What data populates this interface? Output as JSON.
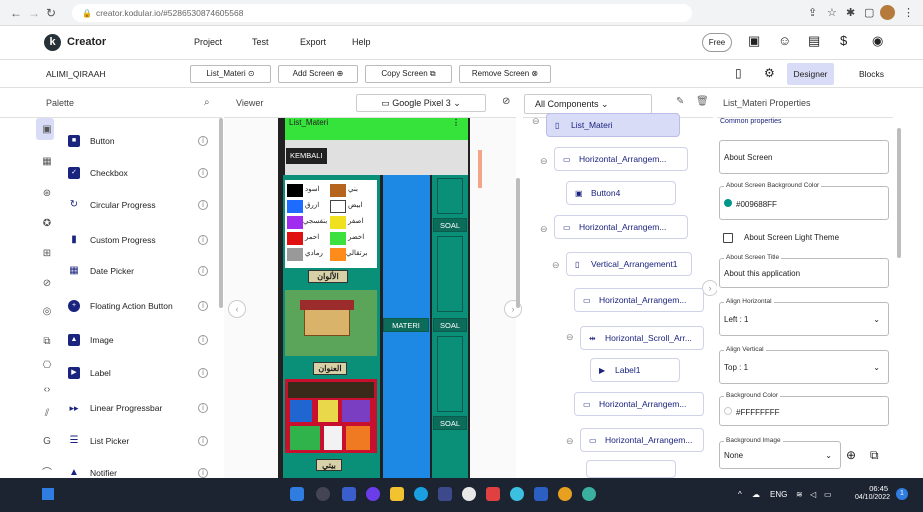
{
  "browser": {
    "url": "creator.kodular.io/#5286530874605568"
  },
  "header": {
    "brand": "Creator",
    "menu": [
      "Project",
      "Test",
      "Export",
      "Help"
    ],
    "free_label": "Free"
  },
  "toolbar": {
    "project_name": "ALIMI_QIRAAH",
    "screen_select": "List_Materi ⊙",
    "add_screen": "Add Screen ⊕",
    "copy_screen": "Copy Screen ⧉",
    "remove_screen": "Remove Screen ⊗",
    "designer": "Designer",
    "blocks": "Blocks"
  },
  "palette": {
    "title": "Palette",
    "items": [
      {
        "label": "Button",
        "icon": "button-icon"
      },
      {
        "label": "Checkbox",
        "icon": "checkbox-icon"
      },
      {
        "label": "Circular Progress",
        "icon": "circular-progress-icon"
      },
      {
        "label": "Custom Progress",
        "icon": "custom-progress-icon"
      },
      {
        "label": "Date Picker",
        "icon": "date-picker-icon"
      },
      {
        "label": "Floating Action Button",
        "icon": "fab-icon"
      },
      {
        "label": "Image",
        "icon": "image-icon"
      },
      {
        "label": "Label",
        "icon": "label-icon"
      },
      {
        "label": "Linear Progressbar",
        "icon": "linear-progress-icon"
      },
      {
        "label": "List Picker",
        "icon": "list-picker-icon"
      },
      {
        "label": "Notifier",
        "icon": "notifier-icon"
      }
    ]
  },
  "viewer": {
    "title": "Viewer",
    "device": "Google Pixel 3",
    "screen_title": "List_Materi",
    "back_button": "KEMBALI",
    "colors_left": [
      "اسود",
      "ازرق",
      "بنفسجي",
      "احمر",
      "رمادي"
    ],
    "colors_right": [
      "بني",
      "ابيض",
      "اصفر",
      "اخضر",
      "برتقالي"
    ],
    "caption1": "الألوان",
    "caption2": "العنوان",
    "caption3": "بيتي",
    "materi_button": "MATERI",
    "soal_buttons": [
      "SOAL",
      "SOAL",
      "SOAL"
    ]
  },
  "components": {
    "dropdown": "All Components",
    "nodes": [
      "List_Materi",
      "Horizontal_Arrangem...",
      "Button4",
      "Horizontal_Arrangem...",
      "Vertical_Arrangement1",
      "Horizontal_Arrangem...",
      "Horizontal_Scroll_Arr...",
      "Label1",
      "Horizontal_Arrangem...",
      "Horizontal_Arrangem..."
    ]
  },
  "properties": {
    "title": "List_Materi Properties",
    "section": "Common properties",
    "about_screen": "About Screen",
    "bg_color_legend": "About Screen Background Color",
    "bg_color_value": "#009688FF",
    "light_theme_label": "About Screen Light Theme",
    "title_legend": "About Screen Title",
    "title_value": "About this application",
    "align_h_legend": "Align Horizontal",
    "align_h_value": "Left : 1",
    "align_v_legend": "Align Vertical",
    "align_v_value": "Top : 1",
    "bgc_legend": "Background Color",
    "bgc_value": "#FFFFFFFF",
    "bgi_legend": "Background Image",
    "bgi_value": "None"
  },
  "taskbar": {
    "lang": "ENG",
    "time": "06:45",
    "date": "04/10/2022",
    "notif_count": "1"
  },
  "colors": {
    "teal": "#009688",
    "screen_green": "#36e33a",
    "accent_navy": "#1a237e",
    "selected_blue": "#d9dcf7"
  }
}
